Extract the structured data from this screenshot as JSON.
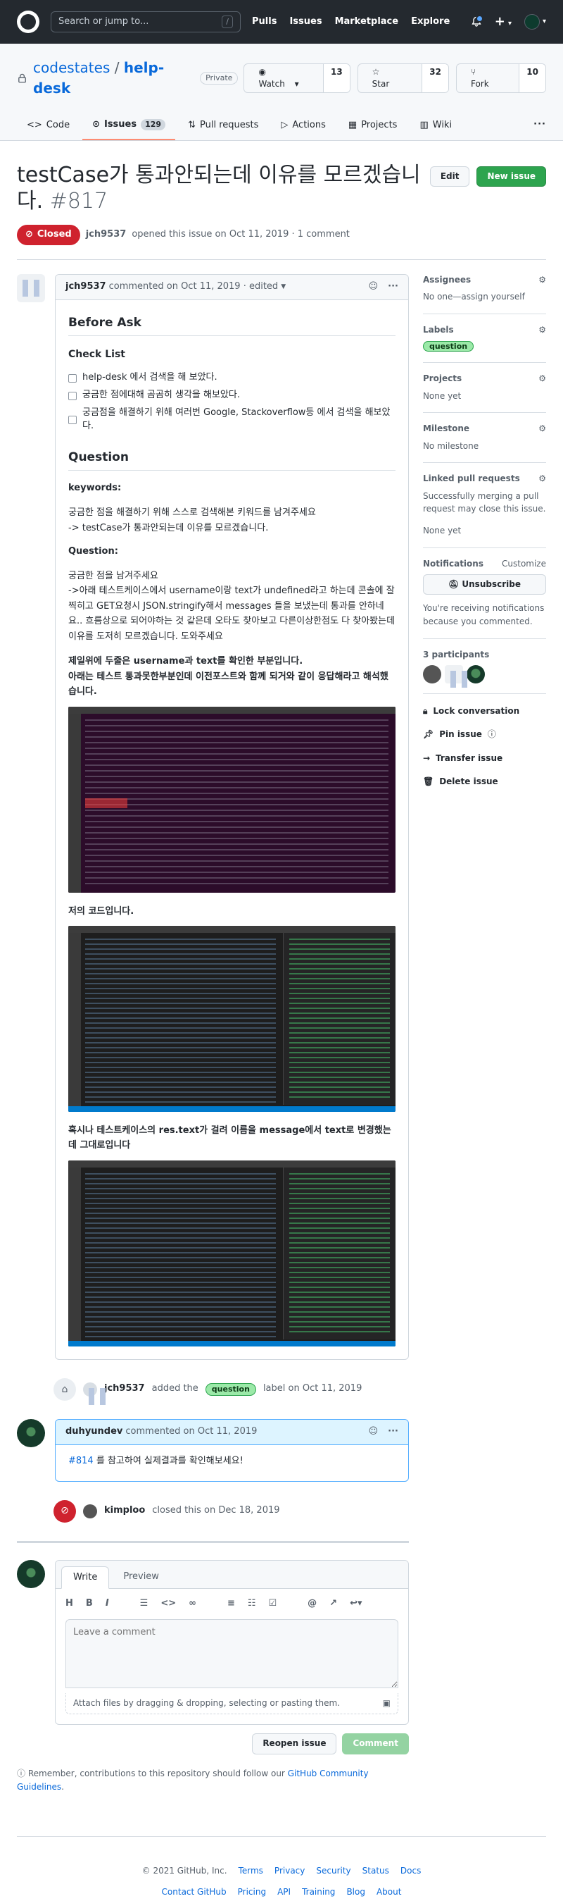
{
  "header": {
    "search_placeholder": "Search or jump to...",
    "slash_key": "/",
    "nav": [
      "Pulls",
      "Issues",
      "Marketplace",
      "Explore"
    ],
    "plus": "+",
    "caret": "▾"
  },
  "repo": {
    "owner": "codestates",
    "separator": "/",
    "name": "help-desk",
    "visibility": "Private",
    "watch": {
      "label": "Watch",
      "count": "13"
    },
    "star": {
      "label": "Star",
      "count": "32"
    },
    "fork": {
      "label": "Fork",
      "count": "10"
    },
    "tabs": [
      {
        "label": "Code",
        "icon": "code-icon"
      },
      {
        "label": "Issues",
        "icon": "issue-icon",
        "count": "129"
      },
      {
        "label": "Pull requests",
        "icon": "pull-request-icon"
      },
      {
        "label": "Actions",
        "icon": "play-icon"
      },
      {
        "label": "Projects",
        "icon": "project-icon"
      },
      {
        "label": "Wiki",
        "icon": "book-icon"
      }
    ],
    "more": "···"
  },
  "issue": {
    "title": "testCase가 통과안되는데 이유를 모르겠습니다.",
    "number": "#817",
    "edit_label": "Edit",
    "new_issue_label": "New issue",
    "state": "Closed",
    "author": "jch9537",
    "meta": "opened this issue on Oct 11, 2019 · 1 comment"
  },
  "first_comment": {
    "author": "jch9537",
    "meta": "commented on Oct 11, 2019 · edited",
    "h_before_ask": "Before Ask",
    "h_checklist": "Check List",
    "tasks": [
      "help-desk 에서 검색을 해 보았다.",
      "궁금한 점에대해 곰곰히 생각을 해보았다.",
      "궁금점을 해결하기 위해 여러번 Google, Stackoverflow등 에서 검색을 해보았다."
    ],
    "h_question": "Question",
    "h_keywords": "keywords:",
    "keywords_text_1": "궁금한 점을 해결하기 위해 스스로 검색해본 키워드를 남겨주세요",
    "keywords_text_2": "-> testCase가 통과안되는데 이유를 모르겠습니다.",
    "h_question_sub": "Question:",
    "question_text_1": "궁금한 점을 남겨주세요",
    "question_text_2": "->아래 테스트케이스에서 username이랑 text가 undefined라고 하는데 콘솔에 잘 찍히고 GET요청시 JSON.stringify해서 messages 들을 보냈는데 통과를 안하네요.. 흐름상으로 되어야하는 것 같은데 오타도 찾아보고 다른이상한점도 다 찾아봤는데 이유를 도저히 모르겠습니다. 도와주세요",
    "bold_text_1": "제일위에 두줄은 username과 text를 확인한 부분입니다.",
    "bold_text_2": "아래는 테스트 통과못한부분인데 이전포스트와 함께 되거와 같이 응답해라고 해석했습니다.",
    "my_code_label": "저의 코드입니다.",
    "bold_text_3": "혹시나 테스트케이스의 res.text가 걸려 이름을 message에서 text로 변경했는데 그대로입니다"
  },
  "label_event": {
    "author": "jch9537",
    "pre": "added the",
    "label": "question",
    "post": "label on Oct 11, 2019"
  },
  "second_comment": {
    "author": "duhyundev",
    "meta": "commented on Oct 11, 2019",
    "ref": "#814",
    "text": "를 참고하여 실제결과를 확인해보세요!"
  },
  "closed_event": {
    "author": "kimploo",
    "text": "closed this on Dec 18, 2019"
  },
  "composer": {
    "tab_write": "Write",
    "tab_preview": "Preview",
    "placeholder": "Leave a comment",
    "attach_text": "Attach files by dragging & dropping, selecting or pasting them.",
    "reopen_label": "Reopen issue",
    "comment_label": "Comment",
    "reminder_pre": "Remember, contributions to this repository should follow our",
    "reminder_link": "GitHub Community Guidelines",
    "reminder_post": "."
  },
  "sidebar": {
    "assignees_title": "Assignees",
    "assignees_text": "No one—assign yourself",
    "labels_title": "Labels",
    "label": "question",
    "projects_title": "Projects",
    "projects_text": "None yet",
    "milestone_title": "Milestone",
    "milestone_text": "No milestone",
    "linked_title": "Linked pull requests",
    "linked_text": "Successfully merging a pull request may close this issue.",
    "linked_none": "None yet",
    "notifications_title": "Notifications",
    "customize": "Customize",
    "unsubscribe": "Unsubscribe",
    "notif_text": "You're receiving notifications because you commented.",
    "participants_title": "3 participants",
    "lock": "Lock conversation",
    "pin": "Pin issue",
    "transfer": "Transfer issue",
    "delete": "Delete issue"
  },
  "footer": {
    "row1": [
      "© 2021 GitHub, Inc.",
      "Terms",
      "Privacy",
      "Security",
      "Status",
      "Docs"
    ],
    "row2": [
      "Contact GitHub",
      "Pricing",
      "API",
      "Training",
      "Blog",
      "About"
    ]
  },
  "colors": {
    "header_bg": "#24292f",
    "closed_red": "#cf222e",
    "green": "#2da44e",
    "link_blue": "#0969da"
  }
}
